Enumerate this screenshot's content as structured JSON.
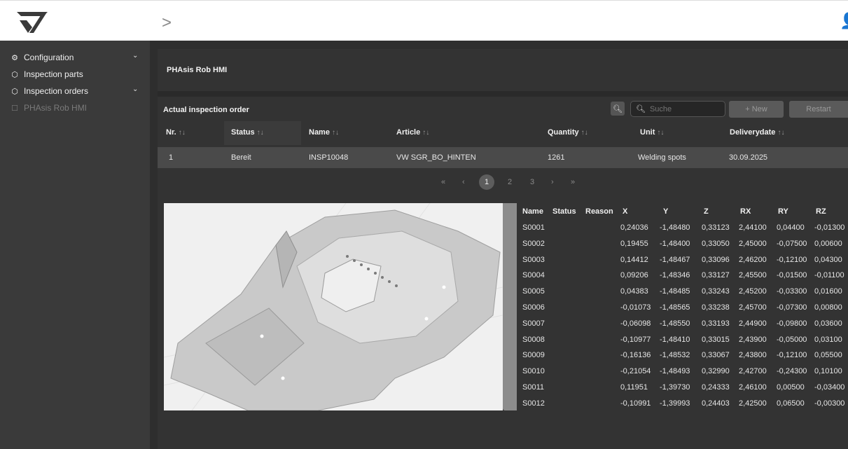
{
  "header": {
    "chevron": ">",
    "user_icon": "user-icon"
  },
  "sidebar": {
    "items": [
      {
        "label": "Configuration",
        "icon": "gear-icon",
        "caret": "⌄"
      },
      {
        "label": "Inspection parts",
        "icon": "box-icon"
      },
      {
        "label": "Inspection orders",
        "icon": "box-icon",
        "caret": "⌄"
      },
      {
        "label": "PHAsis Rob HMI",
        "icon": "window-icon"
      }
    ]
  },
  "page": {
    "title": "PHAsis Rob HMI"
  },
  "orders": {
    "section_title": "Actual inspection order",
    "search_placeholder": "Suche",
    "new_label": "+ New",
    "restart_label": "Restart",
    "sort_icon": "↑↓",
    "columns": [
      "Nr.",
      "Status",
      "Name",
      "Article",
      "Quantity",
      "Unit",
      "Deliverydate"
    ],
    "row": [
      "1",
      "Bereit",
      "INSP10048",
      "VW SGR_BO_HINTEN",
      "1261",
      "Welding spots",
      "30.09.2025"
    ],
    "pagination": {
      "first": "«",
      "prev": "‹",
      "pages": [
        "1",
        "2",
        "3"
      ],
      "next": "›",
      "last": "»",
      "active": "1"
    }
  },
  "points": {
    "columns": [
      "Name",
      "Status",
      "Reason",
      "X",
      "Y",
      "Z",
      "RX",
      "RY",
      "RZ"
    ],
    "rows": [
      [
        "S0001",
        "",
        "",
        "0,24036",
        "-1,48480",
        "0,33123",
        "2,44100",
        "0,04400",
        "-0,01300"
      ],
      [
        "S0002",
        "",
        "",
        "0,19455",
        "-1,48400",
        "0,33050",
        "2,45000",
        "-0,07500",
        "0,00600"
      ],
      [
        "S0003",
        "",
        "",
        "0,14412",
        "-1,48467",
        "0,33096",
        "2,46200",
        "-0,12100",
        "0,04300"
      ],
      [
        "S0004",
        "",
        "",
        "0,09206",
        "-1,48346",
        "0,33127",
        "2,45500",
        "-0,01500",
        "-0,01100"
      ],
      [
        "S0005",
        "",
        "",
        "0,04383",
        "-1,48485",
        "0,33243",
        "2,45200",
        "-0,03300",
        "0,01600"
      ],
      [
        "S0006",
        "",
        "",
        "-0,01073",
        "-1,48565",
        "0,33238",
        "2,45700",
        "-0,07300",
        "0,00800"
      ],
      [
        "S0007",
        "",
        "",
        "-0,06098",
        "-1,48550",
        "0,33193",
        "2,44900",
        "-0,09800",
        "0,03600"
      ],
      [
        "S0008",
        "",
        "",
        "-0,10977",
        "-1,48410",
        "0,33015",
        "2,43900",
        "-0,05000",
        "0,03100"
      ],
      [
        "S0009",
        "",
        "",
        "-0,16136",
        "-1,48532",
        "0,33067",
        "2,43800",
        "-0,12100",
        "0,05500"
      ],
      [
        "S0010",
        "",
        "",
        "-0,21054",
        "-1,48493",
        "0,32990",
        "2,42700",
        "-0,24300",
        "0,10100"
      ],
      [
        "S0011",
        "",
        "",
        "0,11951",
        "-1,39730",
        "0,24333",
        "2,46100",
        "0,00500",
        "-0,03400"
      ],
      [
        "S0012",
        "",
        "",
        "-0,10991",
        "-1,39993",
        "0,24403",
        "2,42500",
        "0,06500",
        "-0,00300"
      ]
    ]
  }
}
